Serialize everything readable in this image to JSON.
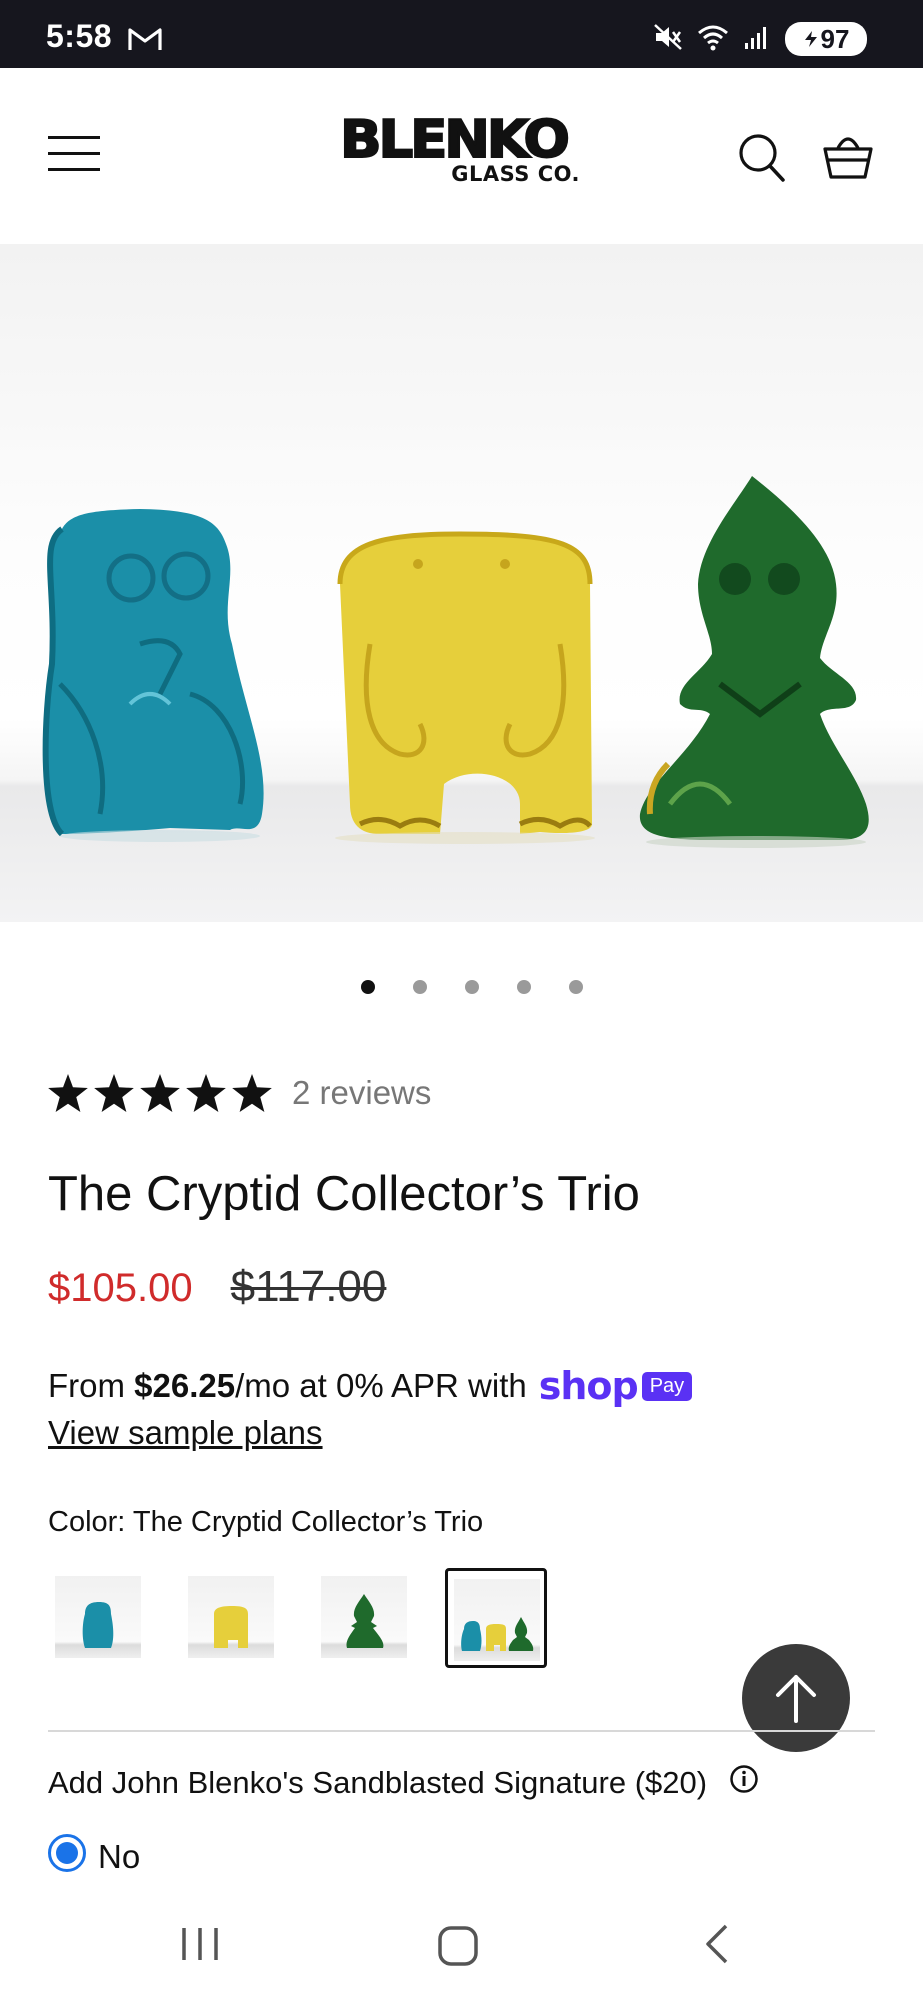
{
  "status_bar": {
    "time": "5:58",
    "battery": "97",
    "icons": [
      "gmail-icon",
      "mute-icon",
      "wifi-icon",
      "signal-icon",
      "battery-icon"
    ]
  },
  "header": {
    "logo_main": "BLENKO",
    "logo_sub": "GLASS CO.",
    "icons": [
      "menu-icon",
      "search-icon",
      "cart-icon"
    ]
  },
  "gallery": {
    "slide_count": 5,
    "active_slide": 1,
    "figure_colors": [
      "#1b8fa8",
      "#e6cf3b",
      "#1f6a2c"
    ]
  },
  "product": {
    "rating": 5,
    "reviews_label": "2 reviews",
    "title": "The Cryptid Collector’s Trio",
    "sale_price": "$105.00",
    "original_price": "$117.00",
    "sale_color": "#d02b2b"
  },
  "shop_pay": {
    "prefix": "From ",
    "amount": "$26.25",
    "suffix": "/mo at 0% APR with",
    "shop_word": "shop",
    "pay_badge": "Pay",
    "view_plans": "View sample plans",
    "brand_color": "#5a31f4"
  },
  "options": {
    "color_label": "Color: The Cryptid Collector’s Trio",
    "swatches": [
      {
        "name": "Blue",
        "selected": false
      },
      {
        "name": "Yellow",
        "selected": false
      },
      {
        "name": "Green",
        "selected": false
      },
      {
        "name": "Trio",
        "selected": true
      }
    ],
    "signature_label": "Add John Blenko's Sandblasted Signature ($20)",
    "signature_choice": "No"
  }
}
